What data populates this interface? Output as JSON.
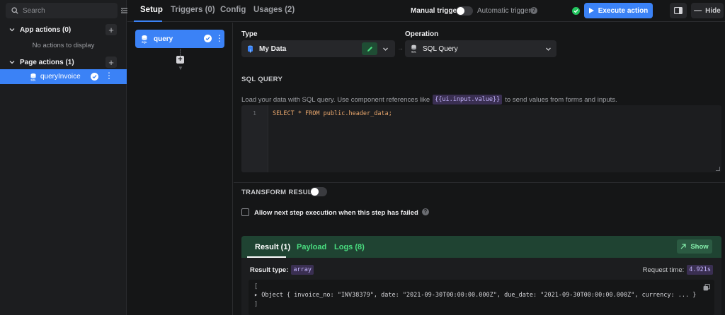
{
  "sidebar": {
    "search_placeholder": "Search",
    "app_actions_label": "App actions (0)",
    "app_actions_empty": "No actions to display",
    "page_actions_label": "Page actions (1)",
    "items": [
      {
        "label": "queryInvoice"
      }
    ]
  },
  "topbar": {
    "tabs": [
      "Setup",
      "Triggers (0)",
      "Config",
      "Usages (2)"
    ],
    "manual_trigger": "Manual trigger",
    "automatic_trigger": "Automatic trigger",
    "help": "?",
    "execute_label": "Execute action",
    "hide_label": "Hide"
  },
  "steps": [
    {
      "label": "query"
    }
  ],
  "config": {
    "type_label": "Type",
    "type_value": "My Data",
    "operation_label": "Operation",
    "operation_value": "SQL Query",
    "sql_heading": "SQL QUERY",
    "desc_prefix": "Load your data with SQL query. Use component references like",
    "desc_chip": "{{ui.input.value}}",
    "desc_suffix": "to send values from forms and inputs.",
    "line_number": "1",
    "sql_code": "SELECT * FROM public.header_data;",
    "transform_label": "TRANSFORM RESULT",
    "allow_next_label": "Allow next step execution when this step has failed"
  },
  "results": {
    "tabs": [
      "Result (1)",
      "Payload",
      "Logs (8)"
    ],
    "show_label": "Show",
    "result_type_label": "Result type:",
    "result_type_value": "array",
    "request_time_label": "Request time:",
    "request_time_value": "4.921s",
    "json_open": "[",
    "json_row": "▸ Object { invoice_no: \"INV38379\", date: \"2021-09-30T00:00:00.000Z\", due_date: \"2021-09-30T00:00:00.000Z\", currency: ... }",
    "json_close": "]"
  },
  "colors": {
    "accent": "#3b82f6",
    "success": "#22c55e",
    "result_header": "#1f4332"
  }
}
